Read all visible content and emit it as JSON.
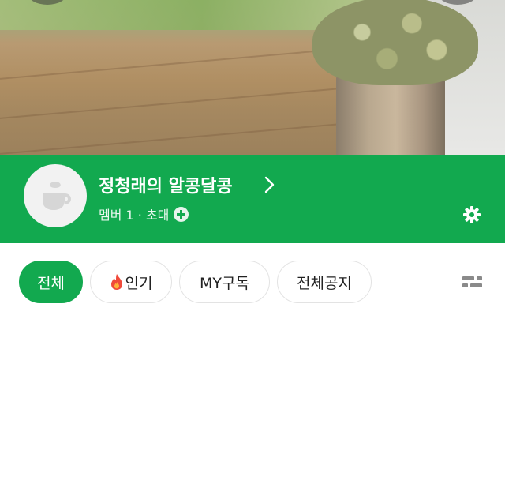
{
  "cafe": {
    "name": "정청래의 알콩달콩",
    "member_line": "멤버 1 · 초대"
  },
  "tabs": [
    {
      "label": "전체",
      "active": true
    },
    {
      "label": "인기",
      "icon": "fire-icon"
    },
    {
      "label": "MY구독"
    },
    {
      "label": "전체공지"
    }
  ],
  "colors": {
    "brand_green": "#12a94f",
    "text_dark": "#222222"
  },
  "icons": [
    "cup-icon",
    "chevron-right-icon",
    "plus-circle-icon",
    "gear-icon",
    "fire-icon",
    "view-toggle-icon"
  ]
}
